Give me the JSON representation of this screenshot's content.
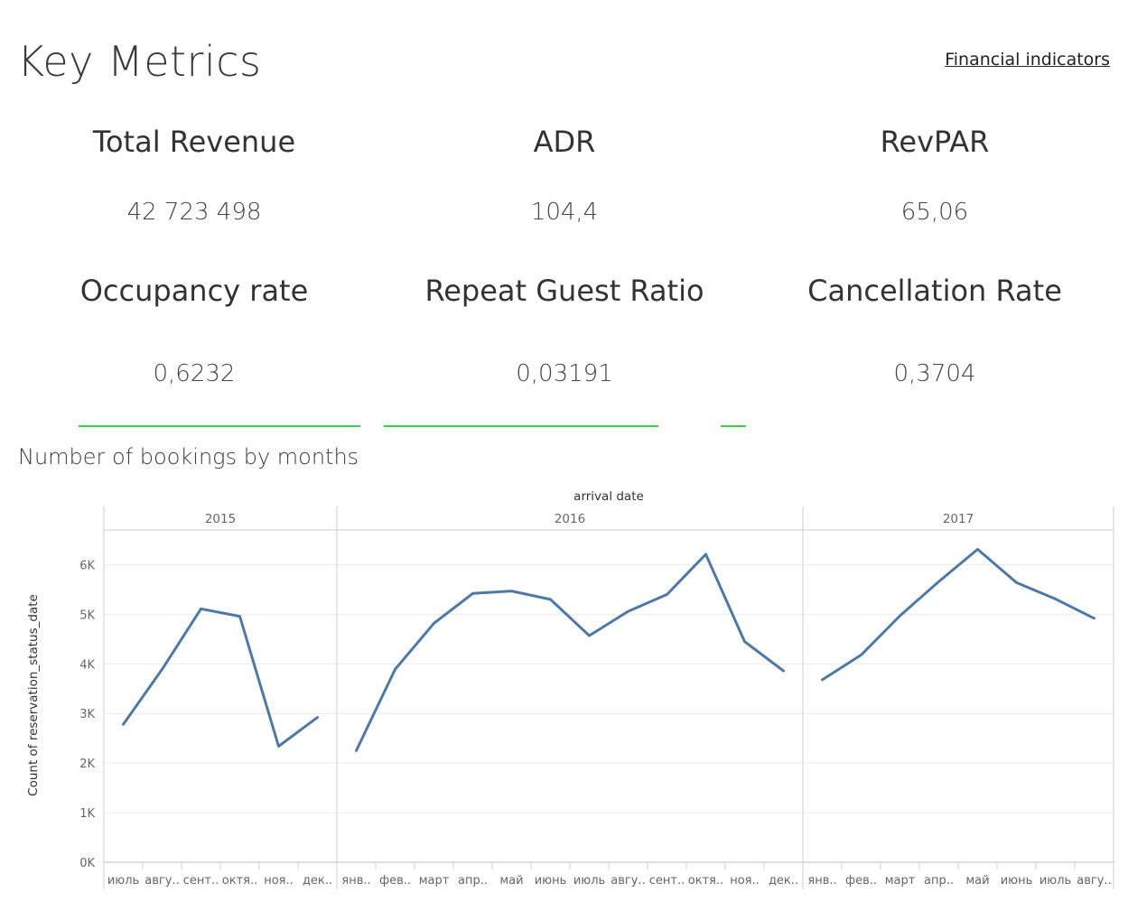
{
  "header": {
    "title": "Key Metrics",
    "link_label": "Financial indicators"
  },
  "kpis": [
    {
      "label": "Total Revenue",
      "value": "42 723 498"
    },
    {
      "label": "ADR",
      "value": "104,4"
    },
    {
      "label": "RevPAR",
      "value": "65,06"
    },
    {
      "label": "Occupancy rate",
      "value": "0,6232"
    },
    {
      "label": "Repeat Guest Ratio",
      "value": "0,03191"
    },
    {
      "label": "Cancellation Rate",
      "value": "0,3704"
    }
  ],
  "colors": {
    "line": "#4e79a7",
    "accent_green": "#3ad14b",
    "grid": "#ececec",
    "divider": "#cfcfcf"
  },
  "chart_title": "Number of bookings by months",
  "chart_data": {
    "type": "line",
    "title": "Number of bookings by months",
    "x_header": "arrival date",
    "ylabel": "Count of reservation_status_date",
    "ylim": [
      0,
      6700
    ],
    "y_ticks": [
      {
        "value": 0,
        "label": "0K"
      },
      {
        "value": 1000,
        "label": "1K"
      },
      {
        "value": 2000,
        "label": "2K"
      },
      {
        "value": 3000,
        "label": "3K"
      },
      {
        "value": 4000,
        "label": "4K"
      },
      {
        "value": 5000,
        "label": "5K"
      },
      {
        "value": 6000,
        "label": "6K"
      }
    ],
    "grid": "horizontal",
    "panels": [
      {
        "year": "2015",
        "months": [
          "июль",
          "авгу..",
          "сент..",
          "октя..",
          "ноя..",
          "дек.."
        ],
        "values": [
          2780,
          3890,
          5110,
          4960,
          2340,
          2920
        ]
      },
      {
        "year": "2016",
        "months": [
          "янв..",
          "фев..",
          "март",
          "апр..",
          "май",
          "июнь",
          "июль",
          "авгу..",
          "сент..",
          "октя..",
          "ноя..",
          "дек.."
        ],
        "values": [
          2250,
          3890,
          4820,
          5420,
          5470,
          5300,
          4570,
          5060,
          5400,
          6210,
          4450,
          3860
        ]
      },
      {
        "year": "2017",
        "months": [
          "янв..",
          "фев..",
          "март",
          "апр..",
          "май",
          "июнь",
          "июль",
          "авгу.."
        ],
        "values": [
          3680,
          4180,
          4970,
          5660,
          6310,
          5640,
          5310,
          4920
        ]
      }
    ]
  }
}
